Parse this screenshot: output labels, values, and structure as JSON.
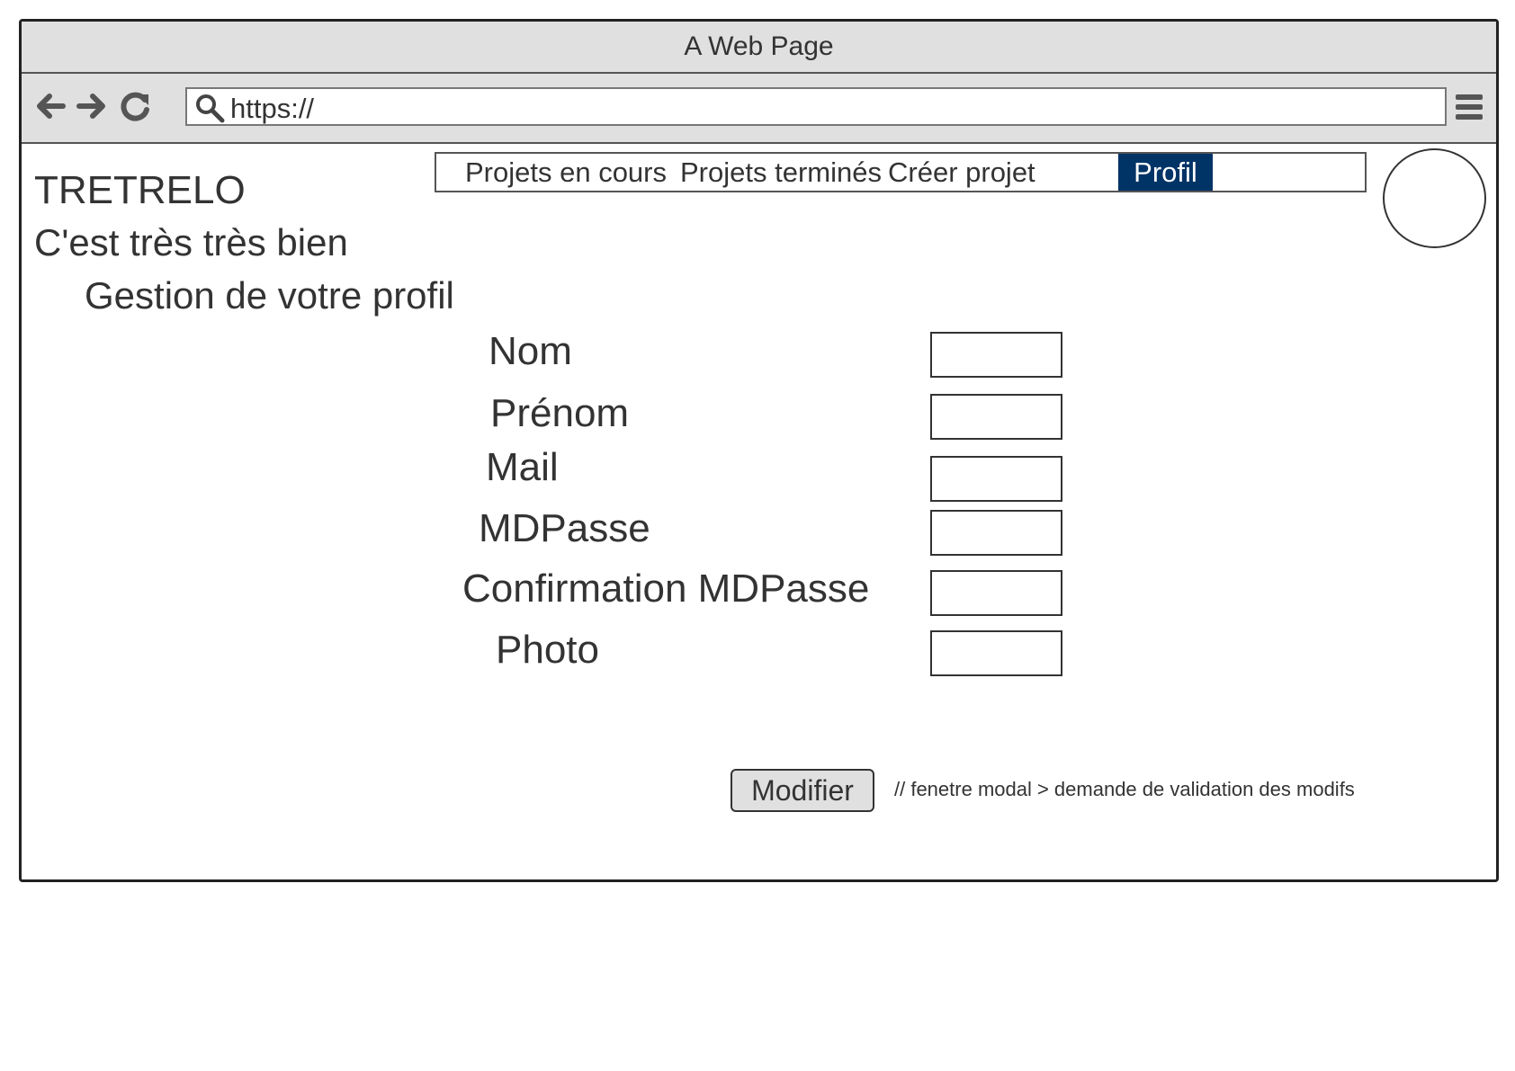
{
  "window": {
    "title": "A Web Page"
  },
  "browser": {
    "url": "https://",
    "icons": {
      "back": "arrow-left-icon",
      "forward": "arrow-right-icon",
      "reload": "reload-icon",
      "search": "search-icon",
      "menu": "hamburger-menu-icon"
    }
  },
  "header": {
    "brand": "TRETRELO",
    "tagline": "C'est très très bien"
  },
  "nav": {
    "tabs": [
      {
        "label": "Projets en cours"
      },
      {
        "label": "Projets terminés"
      },
      {
        "label": "Créer projet"
      },
      {
        "label": "Profil",
        "active": true
      }
    ],
    "active_color": "#003366"
  },
  "main": {
    "title": "Gestion de votre profil",
    "fields": [
      {
        "label": "Nom",
        "value": ""
      },
      {
        "label": "Prénom",
        "value": ""
      },
      {
        "label": "Mail",
        "value": ""
      },
      {
        "label": "MDPasse",
        "value": ""
      },
      {
        "label": "Confirmation MDPasse",
        "value": ""
      },
      {
        "label": "Photo",
        "value": ""
      }
    ],
    "submit_label": "Modifier",
    "note": "// fenetre modal > demande de validation des modifs"
  }
}
